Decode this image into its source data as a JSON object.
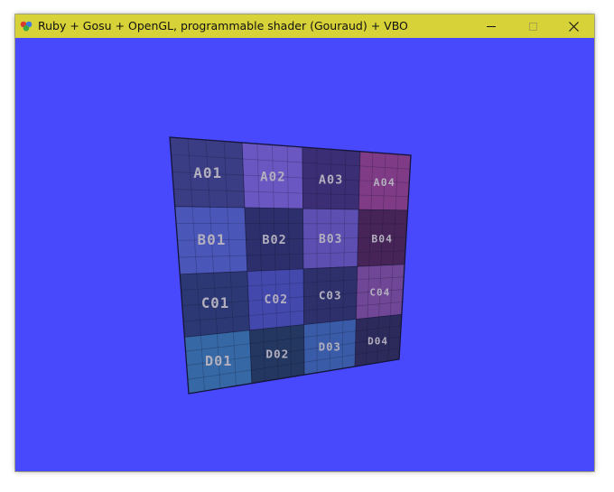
{
  "window": {
    "title": "Ruby + Gosu + OpenGL, programmable shader (Gouraud) + VBO",
    "icon": "gosu-app-icon",
    "controls": {
      "minimize": "minimize-icon",
      "maximize": "maximize-icon",
      "close": "close-icon"
    }
  },
  "canvas": {
    "background": "#4848fd"
  },
  "grid": {
    "rows": [
      "A",
      "B",
      "C",
      "D"
    ],
    "cols": [
      "01",
      "02",
      "03",
      "04"
    ],
    "cells": [
      [
        {
          "label": "A01",
          "color": "#3a3c84"
        },
        {
          "label": "A02",
          "color": "#6a57c2"
        },
        {
          "label": "A03",
          "color": "#3b2e75"
        },
        {
          "label": "A04",
          "color": "#803b86"
        }
      ],
      [
        {
          "label": "B01",
          "color": "#4a56b8"
        },
        {
          "label": "B02",
          "color": "#2d2f6c"
        },
        {
          "label": "B03",
          "color": "#5c4fb1"
        },
        {
          "label": "B04",
          "color": "#462458"
        }
      ],
      [
        {
          "label": "C01",
          "color": "#2c3874"
        },
        {
          "label": "C02",
          "color": "#4348ad"
        },
        {
          "label": "C03",
          "color": "#2e306c"
        },
        {
          "label": "C04",
          "color": "#704696"
        }
      ],
      [
        {
          "label": "D01",
          "color": "#3568a4"
        },
        {
          "label": "D02",
          "color": "#243760"
        },
        {
          "label": "D03",
          "color": "#3a5ca8"
        },
        {
          "label": "D04",
          "color": "#2c2a5a"
        }
      ]
    ]
  }
}
